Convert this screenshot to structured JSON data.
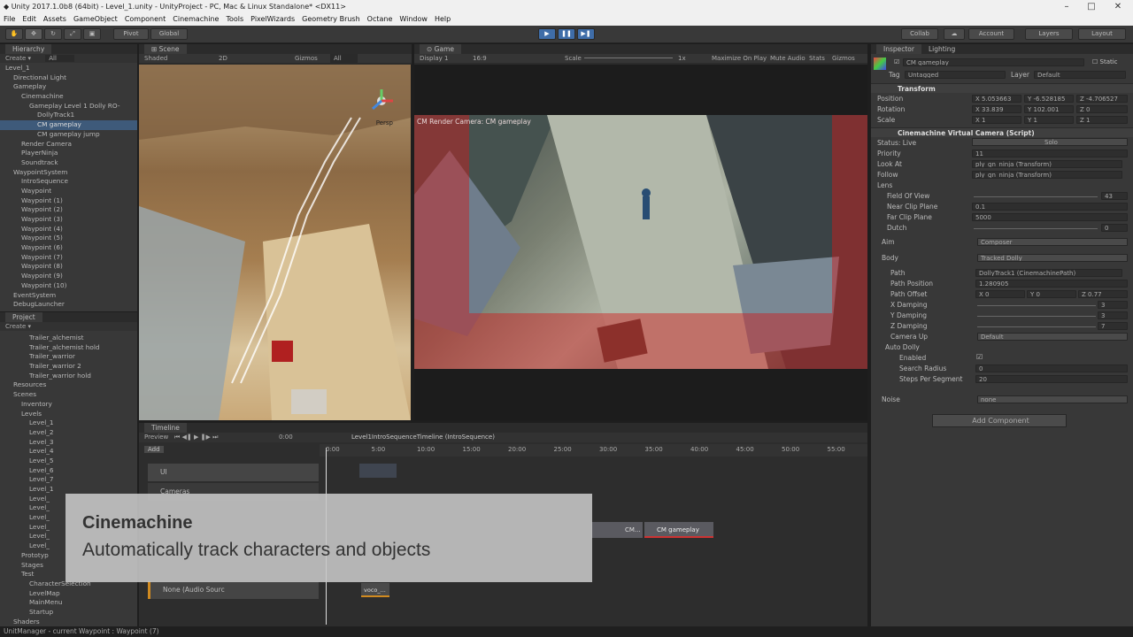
{
  "window": {
    "title": "Unity 2017.1.0b8 (64bit) - Level_1.unity - UnityProject - PC, Mac & Linux Standalone* <DX11>"
  },
  "menu": [
    "File",
    "Edit",
    "Assets",
    "GameObject",
    "Component",
    "Cinemachine",
    "Tools",
    "PixelWizards",
    "Geometry Brush",
    "Octane",
    "Window",
    "Help"
  ],
  "toolbar": {
    "pivot": "Pivot",
    "global": "Global",
    "collab": "Collab",
    "account": "Account",
    "layers": "Layers",
    "layout": "Layout"
  },
  "hierarchy": {
    "tab": "Hierarchy",
    "create": "Create",
    "search_placeholder": "All",
    "items": [
      {
        "label": "Level_1",
        "indent": 0,
        "cls": ""
      },
      {
        "label": "Directional Light",
        "indent": 1,
        "cls": ""
      },
      {
        "label": "Gameplay",
        "indent": 1,
        "cls": ""
      },
      {
        "label": "Cinemachine",
        "indent": 2,
        "cls": ""
      },
      {
        "label": "Gameplay Level 1 Dolly RO-",
        "indent": 3,
        "cls": ""
      },
      {
        "label": "DollyTrack1",
        "indent": 4,
        "cls": ""
      },
      {
        "label": "CM gameplay",
        "indent": 4,
        "cls": "sel"
      },
      {
        "label": "CM gameplay jump",
        "indent": 4,
        "cls": ""
      },
      {
        "label": "Render Camera",
        "indent": 2,
        "cls": ""
      },
      {
        "label": "PlayerNinja",
        "indent": 2,
        "cls": ""
      },
      {
        "label": "Soundtrack",
        "indent": 2,
        "cls": ""
      },
      {
        "label": "WaypointSystem",
        "indent": 1,
        "cls": ""
      },
      {
        "label": "IntroSequence",
        "indent": 2,
        "cls": ""
      },
      {
        "label": "Waypoint",
        "indent": 2,
        "cls": ""
      },
      {
        "label": "Waypoint (1)",
        "indent": 2,
        "cls": ""
      },
      {
        "label": "Waypoint (2)",
        "indent": 2,
        "cls": ""
      },
      {
        "label": "Waypoint (3)",
        "indent": 2,
        "cls": ""
      },
      {
        "label": "Waypoint (4)",
        "indent": 2,
        "cls": ""
      },
      {
        "label": "Waypoint (5)",
        "indent": 2,
        "cls": ""
      },
      {
        "label": "Waypoint (6)",
        "indent": 2,
        "cls": ""
      },
      {
        "label": "Waypoint (7)",
        "indent": 2,
        "cls": ""
      },
      {
        "label": "Waypoint (8)",
        "indent": 2,
        "cls": ""
      },
      {
        "label": "Waypoint (9)",
        "indent": 2,
        "cls": ""
      },
      {
        "label": "Waypoint (10)",
        "indent": 2,
        "cls": ""
      },
      {
        "label": "EventSystem",
        "indent": 1,
        "cls": ""
      },
      {
        "label": "DebugLauncher",
        "indent": 1,
        "cls": ""
      }
    ]
  },
  "project": {
    "tab": "Project",
    "create": "Create",
    "items": [
      {
        "label": "Trailer_alchemist",
        "indent": 3
      },
      {
        "label": "Trailer_alchemist hold",
        "indent": 3
      },
      {
        "label": "Trailer_warrior",
        "indent": 3
      },
      {
        "label": "Trailer_warrior 2",
        "indent": 3
      },
      {
        "label": "Trailer_warrior hold",
        "indent": 3
      },
      {
        "label": "Resources",
        "indent": 1
      },
      {
        "label": "Scenes",
        "indent": 1
      },
      {
        "label": "Inventory",
        "indent": 2
      },
      {
        "label": "Levels",
        "indent": 2
      },
      {
        "label": "Level_1",
        "indent": 3
      },
      {
        "label": "Level_2",
        "indent": 3
      },
      {
        "label": "Level_3",
        "indent": 3
      },
      {
        "label": "Level_4",
        "indent": 3
      },
      {
        "label": "Level_5",
        "indent": 3
      },
      {
        "label": "Level_6",
        "indent": 3
      },
      {
        "label": "Level_7",
        "indent": 3
      },
      {
        "label": "Level_1",
        "indent": 3
      },
      {
        "label": "Level_",
        "indent": 3
      },
      {
        "label": "Level_",
        "indent": 3
      },
      {
        "label": "Level_",
        "indent": 3
      },
      {
        "label": "Level_",
        "indent": 3
      },
      {
        "label": "Level_",
        "indent": 3
      },
      {
        "label": "Level_",
        "indent": 3
      },
      {
        "label": "Prototyp",
        "indent": 2
      },
      {
        "label": "Stages",
        "indent": 2
      },
      {
        "label": "Test",
        "indent": 2
      },
      {
        "label": "CharacterSelection",
        "indent": 3
      },
      {
        "label": "LevelMap",
        "indent": 3
      },
      {
        "label": "MainMenu",
        "indent": 3
      },
      {
        "label": "Startup",
        "indent": 3
      },
      {
        "label": "Shaders",
        "indent": 1
      }
    ]
  },
  "scene": {
    "tab": "Scene",
    "shaded": "Shaded",
    "mode2d": "2D",
    "gizmos": "Gizmos",
    "search": "All",
    "persp": "Persp"
  },
  "game": {
    "tab": "Game",
    "display": "Display 1",
    "aspect": "16:9",
    "scale_label": "Scale",
    "scale_value": "1x",
    "maximize": "Maximize On Play",
    "mute": "Mute Audio",
    "stats": "Stats",
    "gizmos": "Gizmos",
    "overlay_label": "CM Render Camera: CM gameplay"
  },
  "inspector": {
    "tab": "Inspector",
    "tab2": "Lighting",
    "object_name": "CM gameplay",
    "static": "Static",
    "tag_label": "Tag",
    "tag": "Untagged",
    "layer_label": "Layer",
    "layer": "Default",
    "transform": {
      "title": "Transform",
      "position_label": "Position",
      "px": "5.053663",
      "py": "-6.528185",
      "pz": "-4.706527",
      "rotation_label": "Rotation",
      "rx": "33.839",
      "ry": "102.001",
      "rz": "0",
      "scale_label": "Scale",
      "sx": "1",
      "sy": "1",
      "sz": "1"
    },
    "vcam": {
      "title": "Cinemachine Virtual Camera (Script)",
      "status_label": "Status: Live",
      "solo": "Solo",
      "priority_label": "Priority",
      "priority": "11",
      "lookat_label": "Look At",
      "lookat": "ply_gn_ninja (Transform)",
      "follow_label": "Follow",
      "follow": "ply_gn_ninja (Transform)",
      "lens_label": "Lens",
      "fov_label": "Field Of View",
      "fov": "43",
      "near_label": "Near Clip Plane",
      "near": "0.1",
      "far_label": "Far Clip Plane",
      "far": "5000",
      "dutch_label": "Dutch",
      "dutch": "0",
      "aim_label": "Aim",
      "aim": "Composer",
      "body_label": "Body",
      "body": "Tracked Dolly",
      "path_label": "Path",
      "path": "DollyTrack1 (CinemachinePath)",
      "pathpos_label": "Path Position",
      "pathpos": "1.280905",
      "pathoff_label": "Path Offset",
      "ox": "0",
      "oy": "0",
      "oz": "0.77",
      "xdamp_label": "X Damping",
      "xdamp": "3",
      "ydamp_label": "Y Damping",
      "ydamp": "3",
      "zdamp_label": "Z Damping",
      "zdamp": "7",
      "camup_label": "Camera Up",
      "camup": "Default",
      "autodolly_label": "Auto Dolly",
      "enabled_label": "Enabled",
      "radius_label": "Search Radius",
      "radius": "0",
      "steps_label": "Steps Per Segment",
      "steps": "20",
      "noise_label": "Noise",
      "noise": "none"
    },
    "add_component": "Add Component"
  },
  "timeline": {
    "tab": "Timeline",
    "preview": "Preview",
    "time": "0:00",
    "title": "Level1IntroSequenceTimeline (IntroSequence)",
    "add": "Add",
    "ticks": [
      "0:00",
      "5:00",
      "10:00",
      "15:00",
      "20:00",
      "25:00",
      "30:00",
      "35:00",
      "40:00",
      "45:00",
      "50:00",
      "55:00"
    ],
    "tracks": [
      {
        "label": "UI"
      },
      {
        "label": "Cameras"
      },
      {
        "label": "None (Audio Sourc"
      }
    ],
    "clips": {
      "cm1": "CM...",
      "cm2": "CM gameplay",
      "vo": "voco_..."
    }
  },
  "caption": {
    "title": "Cinemachine",
    "subtitle": "Automatically track characters and objects"
  },
  "status": "UnitManager - current Waypoint : Waypoint (7)"
}
